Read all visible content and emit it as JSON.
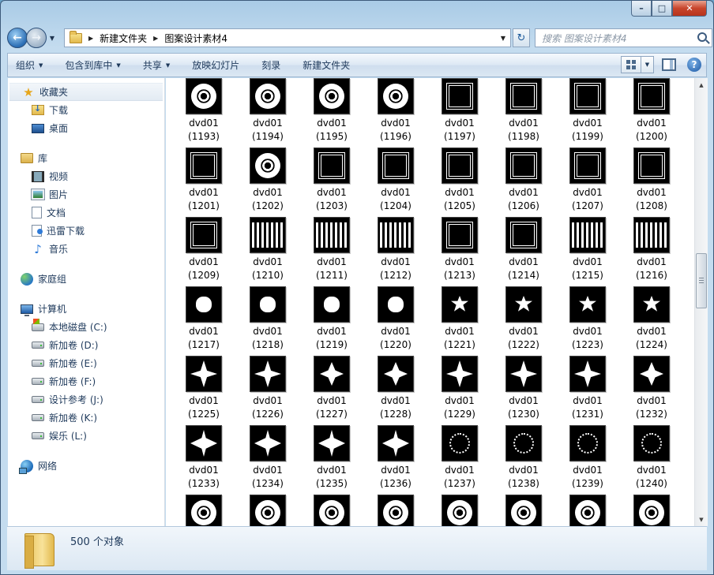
{
  "window": {
    "caption": {
      "minimize": "–",
      "maximize": "□",
      "close": "✕"
    }
  },
  "address": {
    "crumbs": [
      "新建文件夹",
      "图案设计素材4"
    ],
    "search_placeholder": "搜索 图案设计素材4"
  },
  "toolbar": {
    "organize": "组织",
    "include_library": "包含到库中",
    "share": "共享",
    "slideshow": "放映幻灯片",
    "burn": "刻录",
    "new_folder": "新建文件夹",
    "help": "?"
  },
  "sidebar": {
    "favorites": {
      "label": "收藏夹",
      "items": [
        "下载",
        "桌面"
      ]
    },
    "libraries": {
      "label": "库",
      "items": [
        "视频",
        "图片",
        "文档",
        "迅雷下载",
        "音乐"
      ]
    },
    "homegroup": {
      "label": "家庭组"
    },
    "computer": {
      "label": "计算机",
      "items": [
        "本地磁盘 (C:)",
        "新加卷 (D:)",
        "新加卷 (E:)",
        "新加卷 (F:)",
        "设计参考 (J:)",
        "新加卷 (K:)",
        "娱乐 (L:)"
      ]
    },
    "network": {
      "label": "网络"
    }
  },
  "files": [
    {
      "name": "dvd01",
      "num": "(1193)",
      "icon": "mandala-pattern"
    },
    {
      "name": "dvd01",
      "num": "(1194)",
      "icon": "mandala-pattern"
    },
    {
      "name": "dvd01",
      "num": "(1195)",
      "icon": "mandala-pattern"
    },
    {
      "name": "dvd01",
      "num": "(1196)",
      "icon": "mandala-pattern"
    },
    {
      "name": "dvd01",
      "num": "(1197)",
      "icon": "frame-pattern"
    },
    {
      "name": "dvd01",
      "num": "(1198)",
      "icon": "frame-pattern"
    },
    {
      "name": "dvd01",
      "num": "(1199)",
      "icon": "frame-pattern"
    },
    {
      "name": "dvd01",
      "num": "(1200)",
      "icon": "frame-pattern"
    },
    {
      "name": "dvd01",
      "num": "(1201)",
      "icon": "frame-pattern"
    },
    {
      "name": "dvd01",
      "num": "(1202)",
      "icon": "mandala-pattern"
    },
    {
      "name": "dvd01",
      "num": "(1203)",
      "icon": "frame-pattern"
    },
    {
      "name": "dvd01",
      "num": "(1204)",
      "icon": "frame-pattern"
    },
    {
      "name": "dvd01",
      "num": "(1205)",
      "icon": "frame-pattern"
    },
    {
      "name": "dvd01",
      "num": "(1206)",
      "icon": "frame-pattern"
    },
    {
      "name": "dvd01",
      "num": "(1207)",
      "icon": "frame-pattern"
    },
    {
      "name": "dvd01",
      "num": "(1208)",
      "icon": "frame-pattern"
    },
    {
      "name": "dvd01",
      "num": "(1209)",
      "icon": "frame-pattern"
    },
    {
      "name": "dvd01",
      "num": "(1210)",
      "icon": "bars-pattern"
    },
    {
      "name": "dvd01",
      "num": "(1211)",
      "icon": "bars-pattern"
    },
    {
      "name": "dvd01",
      "num": "(1212)",
      "icon": "bars-pattern"
    },
    {
      "name": "dvd01",
      "num": "(1213)",
      "icon": "frame-pattern"
    },
    {
      "name": "dvd01",
      "num": "(1214)",
      "icon": "frame-pattern"
    },
    {
      "name": "dvd01",
      "num": "(1215)",
      "icon": "bars-pattern"
    },
    {
      "name": "dvd01",
      "num": "(1216)",
      "icon": "bars-pattern"
    },
    {
      "name": "dvd01",
      "num": "(1217)",
      "icon": "blob-pattern"
    },
    {
      "name": "dvd01",
      "num": "(1218)",
      "icon": "blob-pattern"
    },
    {
      "name": "dvd01",
      "num": "(1219)",
      "icon": "blob-pattern"
    },
    {
      "name": "dvd01",
      "num": "(1220)",
      "icon": "blob-pattern"
    },
    {
      "name": "dvd01",
      "num": "(1221)",
      "icon": "star-pattern"
    },
    {
      "name": "dvd01",
      "num": "(1222)",
      "icon": "star-pattern"
    },
    {
      "name": "dvd01",
      "num": "(1223)",
      "icon": "star-pattern"
    },
    {
      "name": "dvd01",
      "num": "(1224)",
      "icon": "star-pattern"
    },
    {
      "name": "dvd01",
      "num": "(1225)",
      "icon": "diamond-pattern"
    },
    {
      "name": "dvd01",
      "num": "(1226)",
      "icon": "diamond-pattern"
    },
    {
      "name": "dvd01",
      "num": "(1227)",
      "icon": "flower-pattern"
    },
    {
      "name": "dvd01",
      "num": "(1228)",
      "icon": "flower-pattern"
    },
    {
      "name": "dvd01",
      "num": "(1229)",
      "icon": "diamond-pattern"
    },
    {
      "name": "dvd01",
      "num": "(1230)",
      "icon": "diamond-pattern"
    },
    {
      "name": "dvd01",
      "num": "(1231)",
      "icon": "diamond-pattern"
    },
    {
      "name": "dvd01",
      "num": "(1232)",
      "icon": "flower-pattern"
    },
    {
      "name": "dvd01",
      "num": "(1233)",
      "icon": "compass-pattern"
    },
    {
      "name": "dvd01",
      "num": "(1234)",
      "icon": "compass-pattern"
    },
    {
      "name": "dvd01",
      "num": "(1235)",
      "icon": "compass-pattern"
    },
    {
      "name": "dvd01",
      "num": "(1236)",
      "icon": "compass-pattern"
    },
    {
      "name": "dvd01",
      "num": "(1237)",
      "icon": "ring-pattern"
    },
    {
      "name": "dvd01",
      "num": "(1238)",
      "icon": "ring-pattern"
    },
    {
      "name": "dvd01",
      "num": "(1239)",
      "icon": "ring-pattern"
    },
    {
      "name": "dvd01",
      "num": "(1240)",
      "icon": "ring-pattern"
    },
    {
      "name": "",
      "num": "",
      "icon": "mandala-pattern"
    },
    {
      "name": "",
      "num": "",
      "icon": "mandala-pattern"
    },
    {
      "name": "",
      "num": "",
      "icon": "mandala-pattern"
    },
    {
      "name": "",
      "num": "",
      "icon": "mandala-pattern"
    },
    {
      "name": "",
      "num": "",
      "icon": "mandala-pattern"
    },
    {
      "name": "",
      "num": "",
      "icon": "mandala-pattern"
    },
    {
      "name": "",
      "num": "",
      "icon": "mandala-pattern"
    },
    {
      "name": "",
      "num": "",
      "icon": "mandala-pattern"
    }
  ],
  "details": {
    "count": "500 个对象"
  }
}
